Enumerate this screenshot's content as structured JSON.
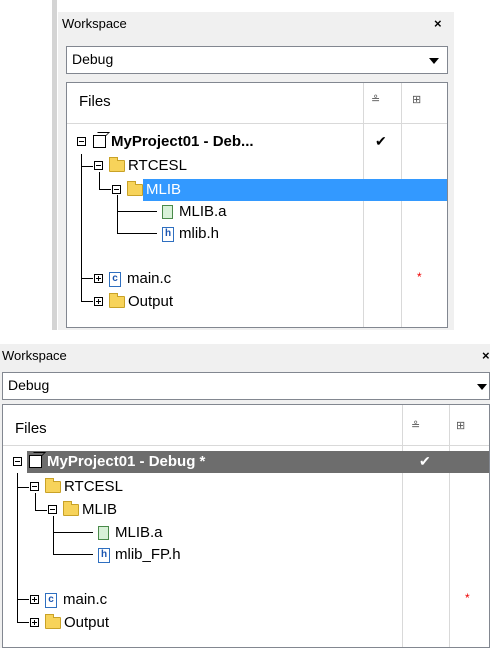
{
  "panels": [
    {
      "title": "Workspace",
      "close": "×",
      "config": "Debug",
      "header": {
        "files": "Files",
        "col1_icon": "≗",
        "col2_icon": "⊞"
      },
      "rows": [
        {
          "label": "MyProject01 - Deb...",
          "check": "✔",
          "star": ""
        },
        {
          "label": "RTCESL",
          "check": "",
          "star": ""
        },
        {
          "label": "MLIB",
          "check": "",
          "star": ""
        },
        {
          "label": "MLIB.a",
          "check": "",
          "star": ""
        },
        {
          "label": "mlib.h",
          "check": "",
          "star": ""
        },
        {
          "label": "main.c",
          "check": "",
          "star": "*"
        },
        {
          "label": "Output",
          "check": "",
          "star": ""
        }
      ]
    },
    {
      "title": "Workspace",
      "close": "×",
      "config": "Debug",
      "header": {
        "files": "Files",
        "col1_icon": "≗",
        "col2_icon": "⊞"
      },
      "rows": [
        {
          "label": "MyProject01 - Debug *",
          "check": "✔",
          "star": ""
        },
        {
          "label": "RTCESL",
          "check": "",
          "star": ""
        },
        {
          "label": "MLIB",
          "check": "",
          "star": ""
        },
        {
          "label": "MLIB.a",
          "check": "",
          "star": ""
        },
        {
          "label": "mlib_FP.h",
          "check": "",
          "star": ""
        },
        {
          "label": "main.c",
          "check": "",
          "star": "*"
        },
        {
          "label": "Output",
          "check": "",
          "star": ""
        }
      ]
    }
  ],
  "colors": {
    "selection": "#3399ff",
    "selection_inactive": "#6d6d6d",
    "folder": "#f7d35a",
    "modified_star": "#e00000"
  }
}
